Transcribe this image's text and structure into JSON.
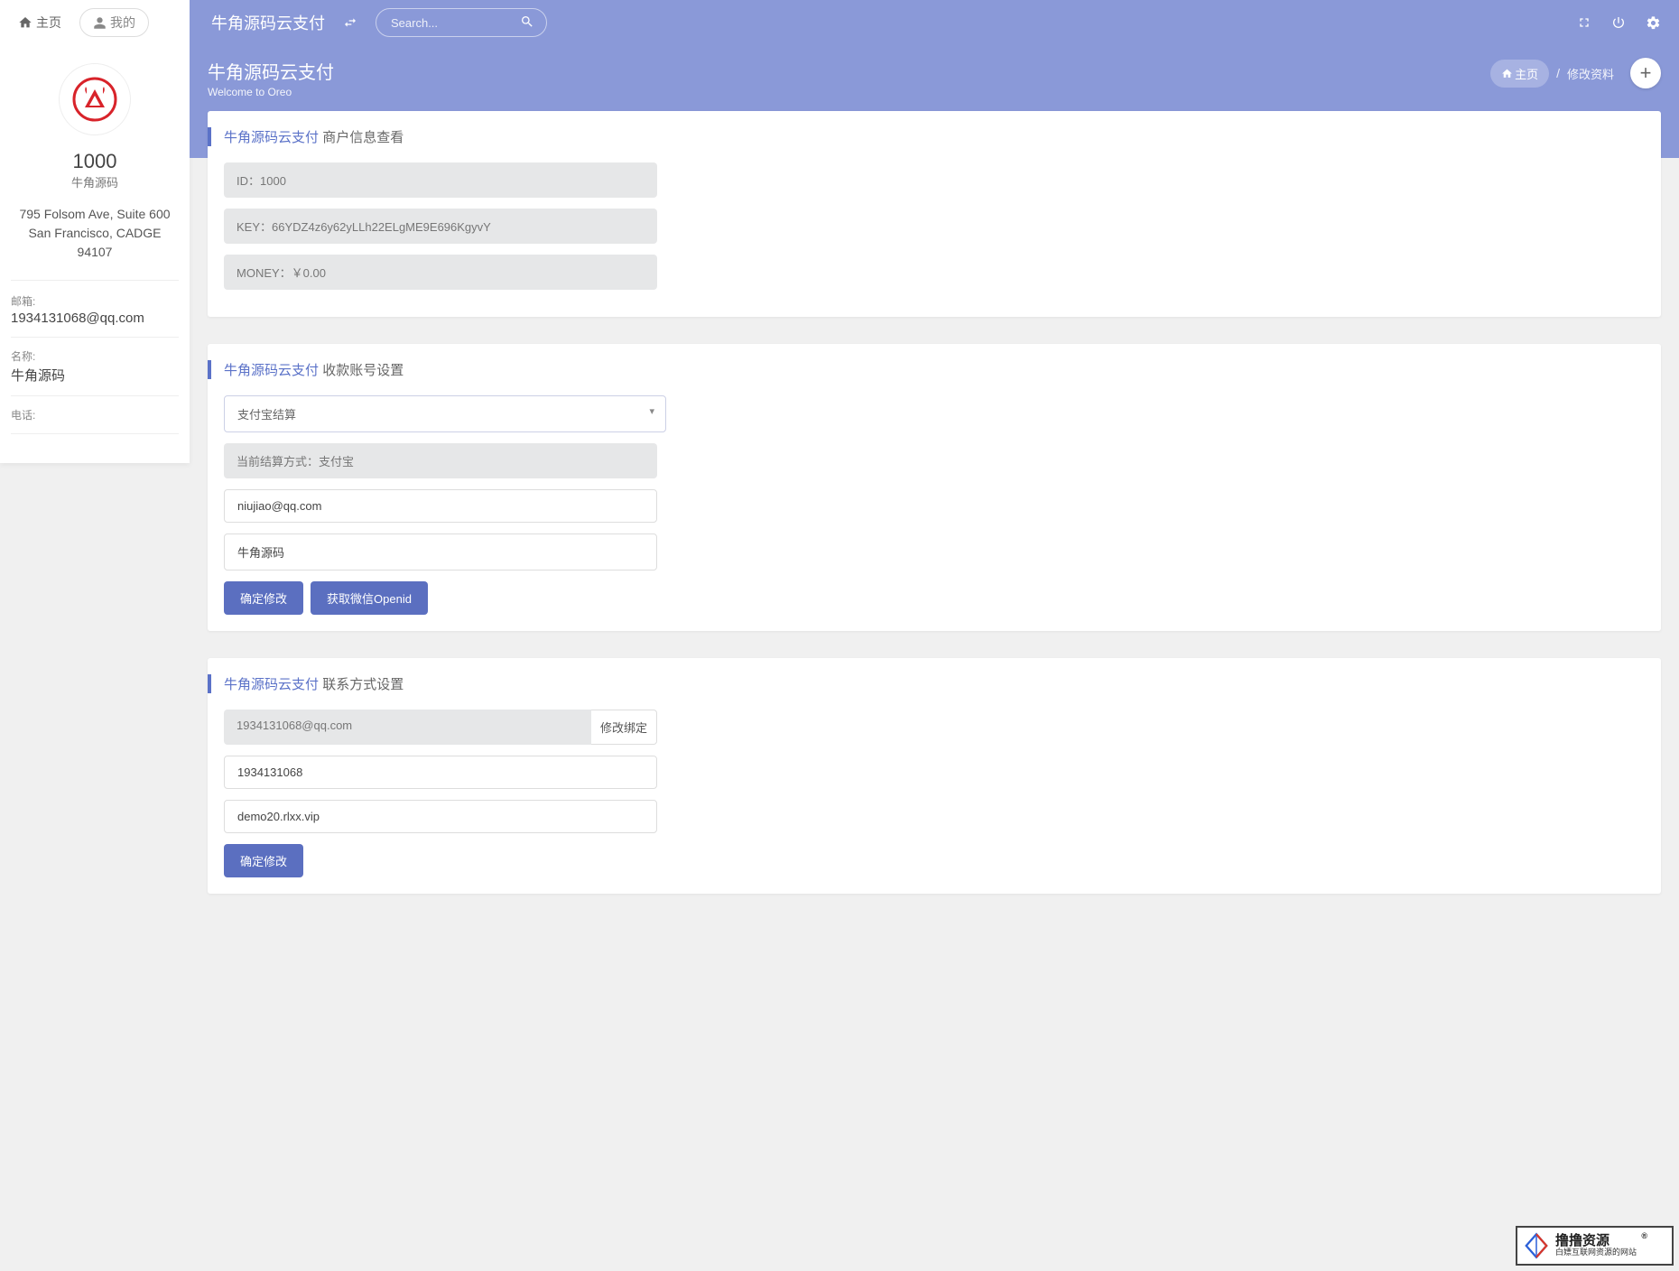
{
  "topnav": {
    "home": "主页",
    "mine": "我的",
    "brand": "牛角源码云支付",
    "search_placeholder": "Search..."
  },
  "sidebar": {
    "user_id": "1000",
    "user_nick": "牛角源码",
    "addr1": "795 Folsom Ave, Suite 600",
    "addr2": "San Francisco, CADGE 94107",
    "email_label": "邮箱:",
    "email": "1934131068@qq.com",
    "name_label": "名称:",
    "name": "牛角源码",
    "phone_label": "电话:"
  },
  "header": {
    "title": "牛角源码云支付",
    "subtitle": "Welcome to Oreo",
    "bc_home": "主页",
    "bc_current": "修改资料"
  },
  "card1": {
    "brand": "牛角源码云支付",
    "title": "商户信息查看",
    "id": "ID：1000",
    "key": "KEY：66YDZ4z6y62yLLh22ELgME9E696KgyvY",
    "money": "MONEY：￥0.00"
  },
  "card2": {
    "brand": "牛角源码云支付",
    "title": "收款账号设置",
    "select": "支付宝结算",
    "current": "当前结算方式：支付宝",
    "email": "niujiao@qq.com",
    "name": "牛角源码",
    "btn1": "确定修改",
    "btn2": "获取微信Openid"
  },
  "card3": {
    "brand": "牛角源码云支付",
    "title": "联系方式设置",
    "email": "1934131068@qq.com",
    "modify": "修改绑定",
    "qq": "1934131068",
    "domain": "demo20.rlxx.vip",
    "btn": "确定修改"
  },
  "watermark": {
    "big": "撸撸资源",
    "small": "白嫖互联网资源的网站"
  }
}
